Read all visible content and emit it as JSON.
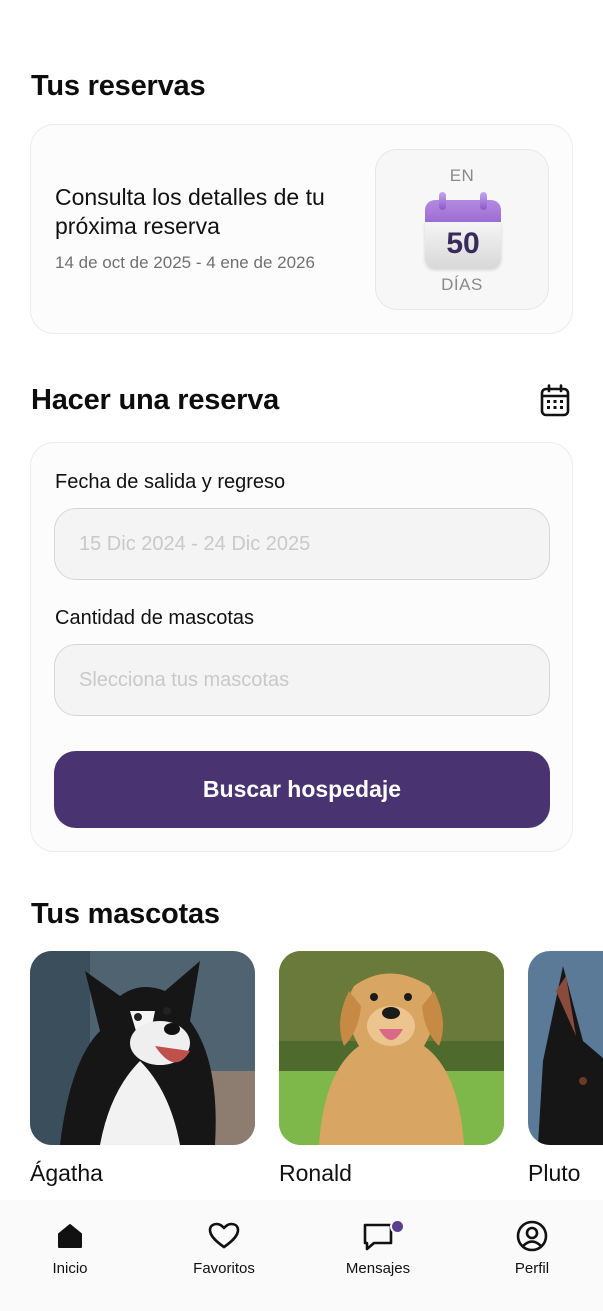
{
  "reservations": {
    "section_title": "Tus reservas",
    "card_title": "Consulta los detalles de tu próxima reserva",
    "date_range": "14 de oct de 2025 - 4 ene de 2026",
    "countdown_prefix": "EN",
    "countdown_value": "50",
    "countdown_suffix": "DÍAS"
  },
  "booking": {
    "section_title": "Hacer una reserva",
    "calendar_icon": "calendar-icon",
    "dates_label": "Fecha de salida y regreso",
    "dates_placeholder": "15 Dic 2024 - 24 Dic 2025",
    "pets_label": "Cantidad de mascotas",
    "pets_placeholder": "Slecciona tus mascotas",
    "search_button": "Buscar hospedaje"
  },
  "pets": {
    "section_title": "Tus mascotas",
    "items": [
      {
        "name": "Ágatha"
      },
      {
        "name": "Ronald"
      },
      {
        "name": "Pluto"
      }
    ]
  },
  "nav": {
    "items": [
      {
        "label": "Inicio",
        "icon": "home-icon"
      },
      {
        "label": "Favoritos",
        "icon": "heart-icon"
      },
      {
        "label": "Mensajes",
        "icon": "message-icon"
      },
      {
        "label": "Perfil",
        "icon": "profile-icon"
      }
    ]
  },
  "colors": {
    "primary": "#4a3371",
    "calendar_accent": "#9868cf",
    "notification_badge": "#5b3f8f"
  }
}
